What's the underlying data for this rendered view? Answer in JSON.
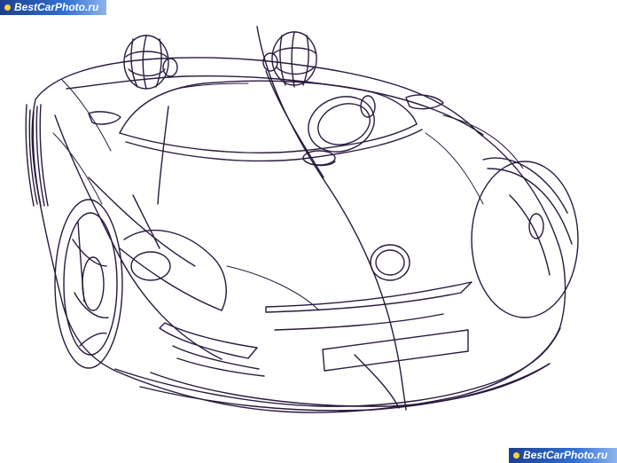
{
  "watermarks": {
    "top_left": "BestCarPhoto.ru",
    "bottom_right": "BestCarPhoto.ru"
  },
  "colors": {
    "line": "#2a1a3e",
    "background": "#ffffff",
    "watermark_bg": "#2f6fd1",
    "watermark_text": "#ffffff"
  },
  "image": {
    "subject": "car-line-sketch"
  }
}
